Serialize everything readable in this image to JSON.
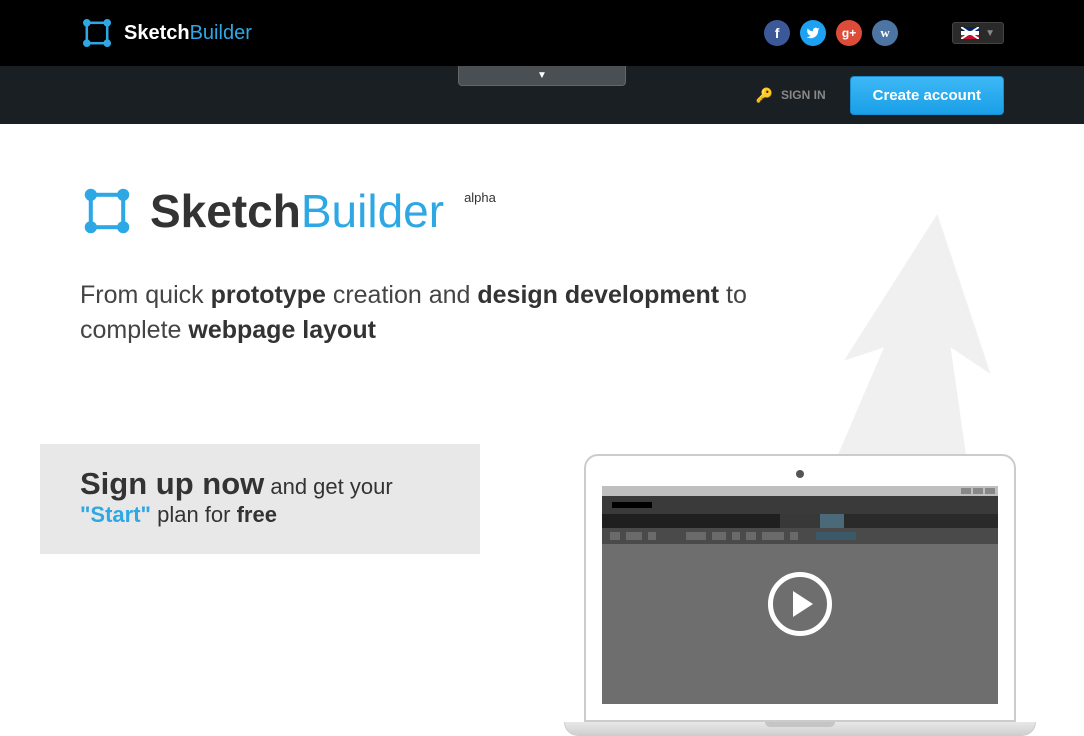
{
  "header": {
    "brand_part1": "Sketch",
    "brand_part2": "Builder",
    "signin_label": "SIGN IN",
    "create_account_label": "Create account"
  },
  "hero": {
    "brand_part1": "Sketch",
    "brand_part2": "Builder",
    "badge": "alpha",
    "tagline_pre": "From quick ",
    "tagline_b1": "prototype",
    "tagline_mid1": " creation and ",
    "tagline_b2": "design development",
    "tagline_mid2": " to complete ",
    "tagline_b3": "webpage layout"
  },
  "signup": {
    "headline": "Sign up now",
    "headline_tail": " and get your",
    "plan_quote": "\"Start\"",
    "plan_tail": " plan for ",
    "free": "free"
  },
  "social": {
    "fb": "f",
    "tw": "",
    "gp": "g+",
    "vk": "w"
  }
}
